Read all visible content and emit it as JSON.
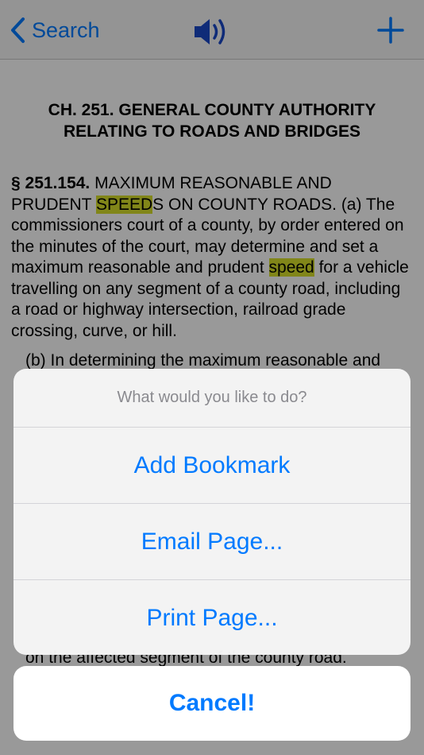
{
  "nav": {
    "back_label": "Search",
    "icons": [
      "chevron-left-icon",
      "speaker-icon",
      "plus-icon"
    ],
    "accent_color": "#007aff"
  },
  "document": {
    "chapter_title": "CH. 251. GENERAL COUNTY AUTHORITY RELATING TO ROADS AND BRIDGES",
    "section_number": "§ 251.154.",
    "section_text_1": " MAXIMUM REASONABLE AND PRUDENT ",
    "highlight_1": "SPEED",
    "section_text_2": "S ON COUNTY ROADS. (a) The commissioners court of a county, by order entered on the minutes of the court, may determine and set a maximum reasonable and prudent ",
    "highlight_2": "speed",
    "section_text_3": " for a vehicle travelling on any segment of a county road, including a road or highway intersection, railroad grade crossing, curve, or hill.",
    "paragraph_b_start": "(b) In determining the maximum reasonable and",
    "paragraph_tail": "on the affected segment of the county road.",
    "highlight_color": "#d7e02a"
  },
  "action_sheet": {
    "title": "What would you like to do?",
    "actions": [
      "Add Bookmark",
      "Email Page...",
      "Print Page..."
    ],
    "cancel_label": "Cancel!"
  }
}
